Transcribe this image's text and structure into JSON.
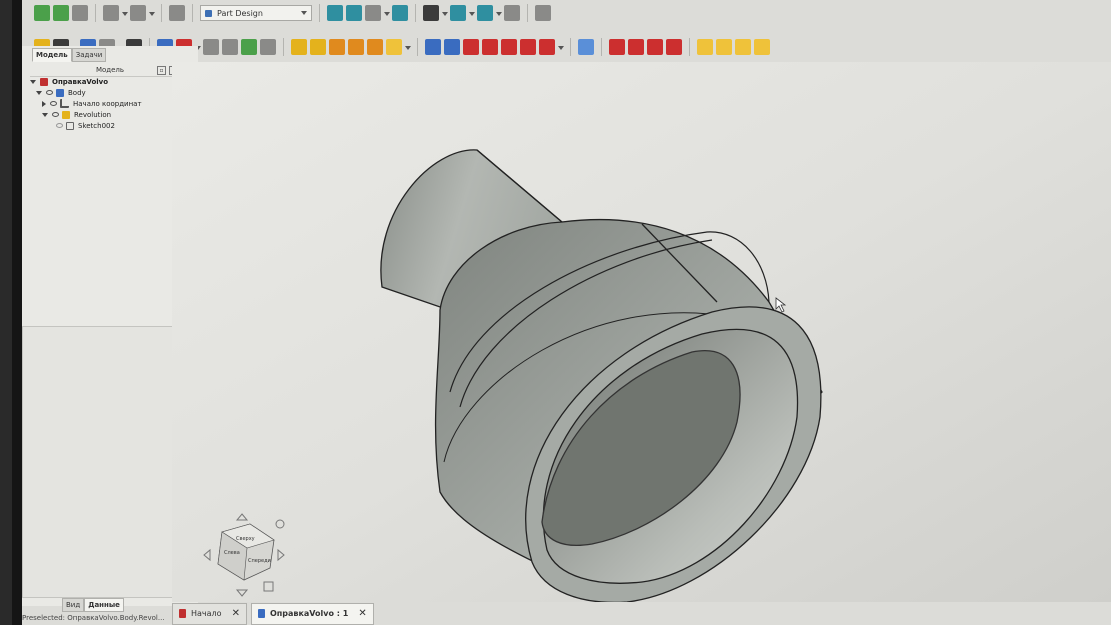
{
  "toolbar": {
    "workbench": "Part Design"
  },
  "left_panel": {
    "tabs": [
      "Модель",
      "Задачи"
    ],
    "header": "Модель",
    "tree": [
      {
        "label": "ОправкаVolvo",
        "level": 0
      },
      {
        "label": "Body",
        "level": 1
      },
      {
        "label": "Начало координат",
        "level": 2
      },
      {
        "label": "Revolution",
        "level": 2
      },
      {
        "label": "Sketch002",
        "level": 3
      }
    ],
    "bottom_tabs": [
      "Вид",
      "Данные"
    ]
  },
  "nav_cube": {
    "faces": [
      "Сверху",
      "Слева",
      "Спереди"
    ]
  },
  "doc_tabs": [
    {
      "label": "Начало",
      "active": false
    },
    {
      "label": "ОправкаVolvo : 1",
      "active": true
    }
  ],
  "status": "Preselected: ОправкаVolvo.Body.Revol...",
  "colors": {
    "model": "#8c918c",
    "model_light": "#b4b8b3",
    "accent": "#3a6cc0"
  }
}
